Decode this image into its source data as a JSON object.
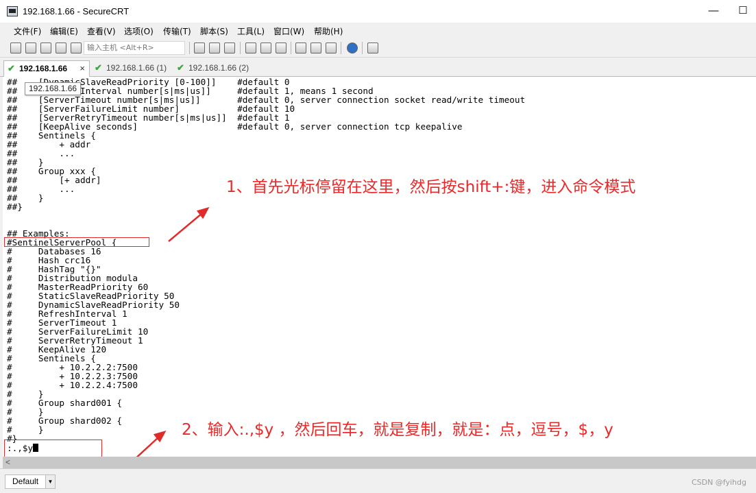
{
  "window": {
    "title": "192.168.1.66 - SecureCRT",
    "minimize": "—",
    "maximize": "☐"
  },
  "menu": [
    "文件(F)",
    "编辑(E)",
    "查看(V)",
    "选项(O)",
    "传输(T)",
    "脚本(S)",
    "工具(L)",
    "窗口(W)",
    "帮助(H)"
  ],
  "toolbar": {
    "quick_connect_placeholder": "输入主机 <Alt+R>"
  },
  "tabs": [
    {
      "label": "192.168.1.66",
      "close": "×"
    },
    {
      "label": "192.168.1.66 (1)"
    },
    {
      "label": "192.168.1.66 (2)"
    }
  ],
  "tooltip": "192.168.1.66",
  "terminal": {
    "lines": [
      "##    [DynamicSlaveReadPriority [0-100]]    #default 0",
      "##    [RefreshInterval number[s|ms|us]]     #default 1, means 1 second",
      "##    [ServerTimeout number[s|ms|us]]       #default 0, server connection socket read/write timeout",
      "##    [ServerFailureLimit number]           #default 10",
      "##    [ServerRetryTimeout number[s|ms|us]]  #default 1",
      "##    [KeepAlive seconds]                   #default 0, server connection tcp keepalive",
      "##    Sentinels {",
      "##        + addr",
      "##        ...",
      "##    }",
      "##    Group xxx {",
      "##        [+ addr]",
      "##        ...",
      "##    }",
      "##}",
      "",
      "",
      "## Examples:",
      "#SentinelServerPool {",
      "#     Databases 16",
      "#     Hash crc16",
      "#     HashTag \"{}\"",
      "#     Distribution modula",
      "#     MasterReadPriority 60",
      "#     StaticSlaveReadPriority 50",
      "#     DynamicSlaveReadPriority 50",
      "#     RefreshInterval 1",
      "#     ServerTimeout 1",
      "#     ServerFailureLimit 10",
      "#     ServerRetryTimeout 1",
      "#     KeepAlive 120",
      "#     Sentinels {",
      "#         + 10.2.2.2:7500",
      "#         + 10.2.2.3:7500",
      "#         + 10.2.2.4:7500",
      "#     }",
      "#     Group shard001 {",
      "#     }",
      "#     Group shard002 {",
      "#     }",
      "#}"
    ],
    "command": ":.,$y"
  },
  "annotations": {
    "step1": "1、首先光标停留在这里，然后按shift+:键，进入命令模式",
    "step2": "2、输入:.,$y ，然后回车，就是复制，就是：点，逗号，$，y"
  },
  "scrollbar": {
    "left_arrow": "<"
  },
  "status": {
    "session": "Default"
  },
  "watermark": "CSDN @fyihdg"
}
